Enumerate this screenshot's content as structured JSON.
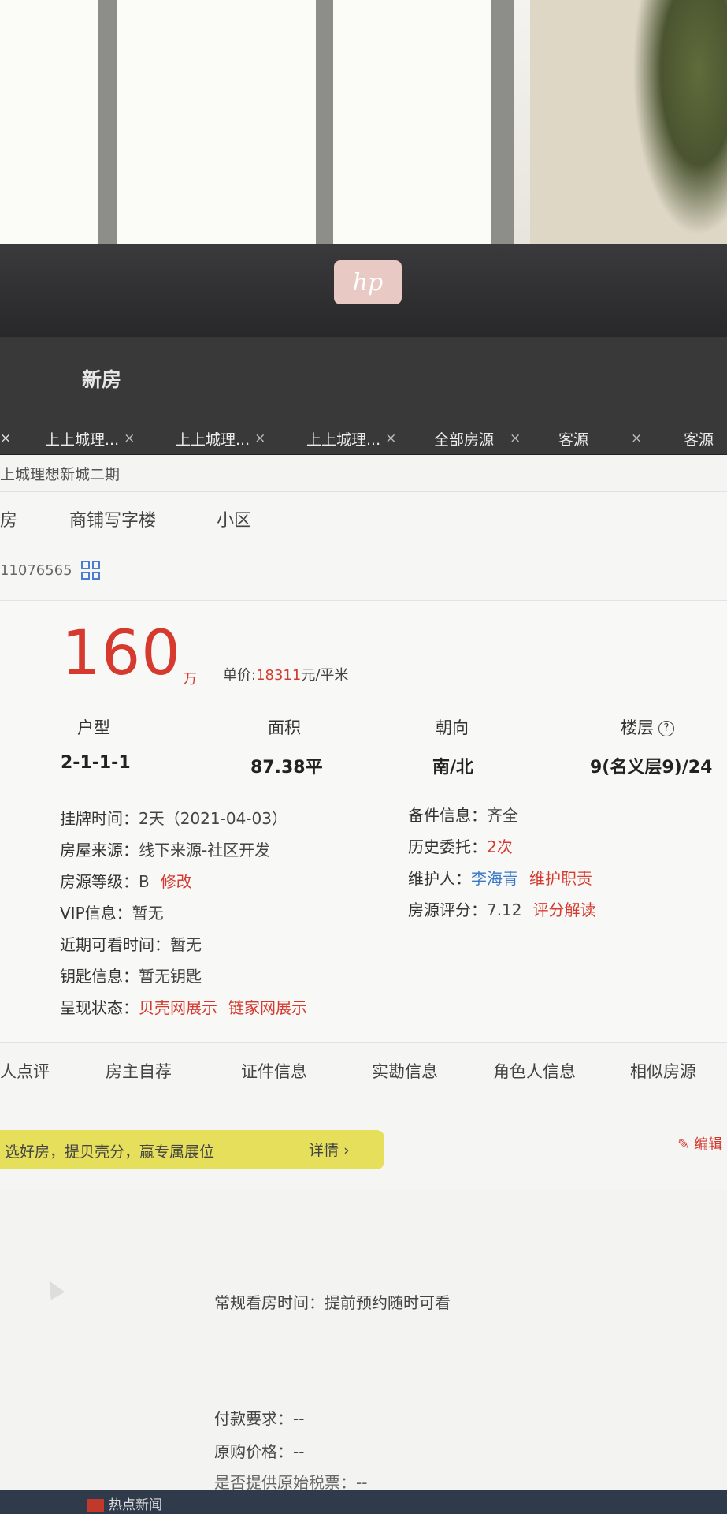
{
  "app": {
    "section_title": "新房",
    "logo": "hp"
  },
  "tabs": [
    {
      "label": "上上城理...",
      "close": "×"
    },
    {
      "label": "上上城理...",
      "close": "×"
    },
    {
      "label": "上上城理...",
      "close": "×"
    },
    {
      "label": "全部房源",
      "close": "×"
    },
    {
      "label": "客源",
      "close": "×"
    },
    {
      "label": "客源"
    }
  ],
  "breadcrumb": "上城理想新城二期",
  "subnav": [
    "房",
    "商铺写字楼",
    "小区"
  ],
  "listing_id": "11076565",
  "price": {
    "amount": "160",
    "unit": "万",
    "unit_price_label": "单价:",
    "unit_price_value": "18311",
    "unit_price_unit": "元/平米"
  },
  "specs": [
    {
      "label": "户型",
      "value": "2-1-1-1"
    },
    {
      "label": "面积",
      "value": "87.38平"
    },
    {
      "label": "朝向",
      "value": "南/北"
    },
    {
      "label": "楼层",
      "value": "9(名义层9)/24"
    }
  ],
  "left_info": [
    {
      "label": "挂牌时间：",
      "value": "2天（2021-04-03）"
    },
    {
      "label": "房屋来源：",
      "value": "线下来源-社区开发"
    },
    {
      "label": "房源等级：",
      "value": "B",
      "link": "修改"
    },
    {
      "label": "VIP信息：",
      "value": "暂无"
    },
    {
      "label": "近期可看时间：",
      "value": "暂无"
    },
    {
      "label": "钥匙信息：",
      "value": "暂无钥匙"
    },
    {
      "label": "呈现状态：",
      "link1": "贝壳网展示",
      "link2": "链家网展示"
    }
  ],
  "right_info": [
    {
      "label": "备件信息：",
      "value": "齐全"
    },
    {
      "label": "历史委托：",
      "value": "2次"
    },
    {
      "label": "维护人：",
      "value": "李海青",
      "link": "维护职责"
    },
    {
      "label": "房源评分：",
      "value": "7.12",
      "link": "评分解读"
    }
  ],
  "section_tabs": [
    "人点评",
    "房主自荐",
    "证件信息",
    "实勘信息",
    "角色人信息",
    "相似房源"
  ],
  "banner": {
    "text": "选好房，提贝壳分，赢专属展位",
    "details": "详情 ›"
  },
  "edit_label": "编辑",
  "viewing_time": "常规看房时间：提前预约随时可看",
  "payment": "付款要求：--",
  "original_price": "原购价格：--",
  "extra_row": "是否提供原始税票：--",
  "taskbar_item": "热点新闻",
  "colors": {
    "accent_red": "#d63a2f",
    "link_blue": "#3a78c6",
    "banner_yellow": "#e6df5c",
    "header_dark": "#3a3939"
  }
}
